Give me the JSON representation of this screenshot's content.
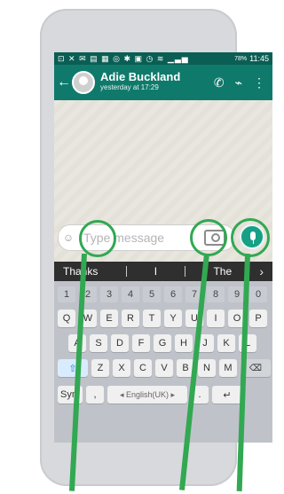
{
  "statusbar": {
    "icons": "⊡ ✕ ✉ ▤ ▦ ◎ ✱ ▣ ◷ ≋ ▁▃▅",
    "battery": "78%",
    "time": "11:45"
  },
  "chat": {
    "name": "Adie Buckland",
    "subtitle": "yesterday at 17:29",
    "back_icon": "←",
    "call_icon": "✆",
    "attach_icon": "⌁",
    "menu_icon": "⋮"
  },
  "composer": {
    "placeholder": "Type message",
    "emoji_icon": "☺"
  },
  "suggestions": {
    "left": "Thanks",
    "middle": "I",
    "right": "The",
    "next_icon": "›"
  },
  "keyboard": {
    "numbers": [
      "1",
      "2",
      "3",
      "4",
      "5",
      "6",
      "7",
      "8",
      "9",
      "0"
    ],
    "row1": [
      "Q",
      "W",
      "E",
      "R",
      "T",
      "Y",
      "U",
      "I",
      "O",
      "P"
    ],
    "row2": [
      "A",
      "S",
      "D",
      "F",
      "G",
      "H",
      "J",
      "K",
      "L"
    ],
    "row3": [
      "Z",
      "X",
      "C",
      "V",
      "B",
      "N",
      "M"
    ],
    "shift_icon": "⇧",
    "delete_icon": "⌫",
    "sym": "Sym",
    "comma": ",",
    "space": "◂ English(UK) ▸",
    "period": ".",
    "enter_icon": "↵"
  }
}
